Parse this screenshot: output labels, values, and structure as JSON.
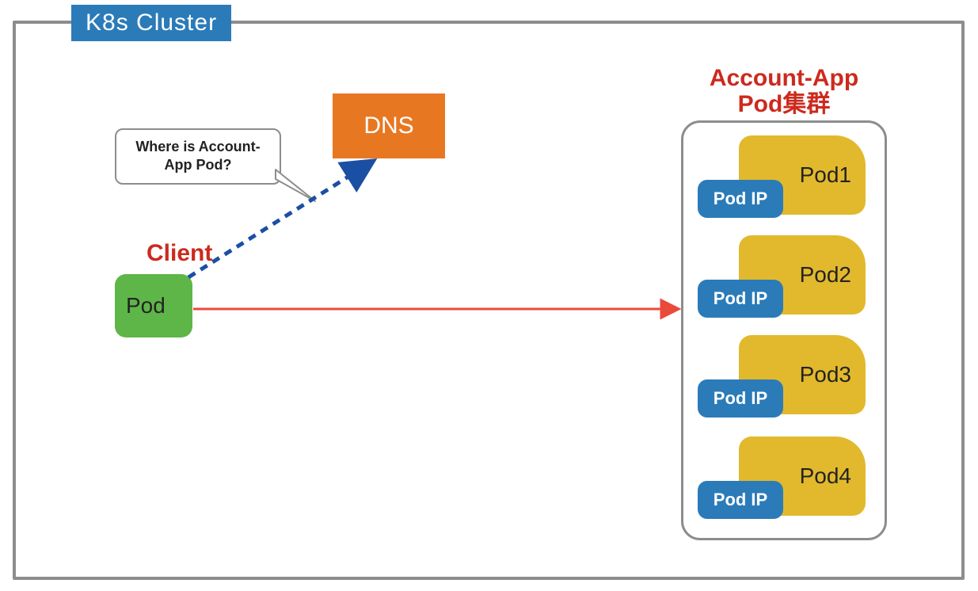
{
  "cluster": {
    "title": "K8s Cluster"
  },
  "dns": {
    "label": "DNS"
  },
  "bubble": {
    "text": "Where is Account-App Pod?"
  },
  "client": {
    "label": "Client",
    "pod_label": "Pod"
  },
  "accountapp": {
    "title_line1": "Account-App",
    "title_line2": "Pod集群",
    "pods": [
      {
        "name": "Pod1",
        "ip_label": "Pod IP"
      },
      {
        "name": "Pod2",
        "ip_label": "Pod IP"
      },
      {
        "name": "Pod3",
        "ip_label": "Pod IP"
      },
      {
        "name": "Pod4",
        "ip_label": "Pod IP"
      }
    ]
  },
  "colors": {
    "cluster_border": "#8d8d8d",
    "cluster_title_bg": "#2b7bb9",
    "dns_bg": "#e87722",
    "client_pod_bg": "#5fb648",
    "accent_red": "#cc2a1e",
    "pod_bg": "#e2b92c",
    "pod_ip_bg": "#2b7bb9",
    "arrow_blue": "#1b4fa3",
    "arrow_red": "#ea4a3c"
  }
}
